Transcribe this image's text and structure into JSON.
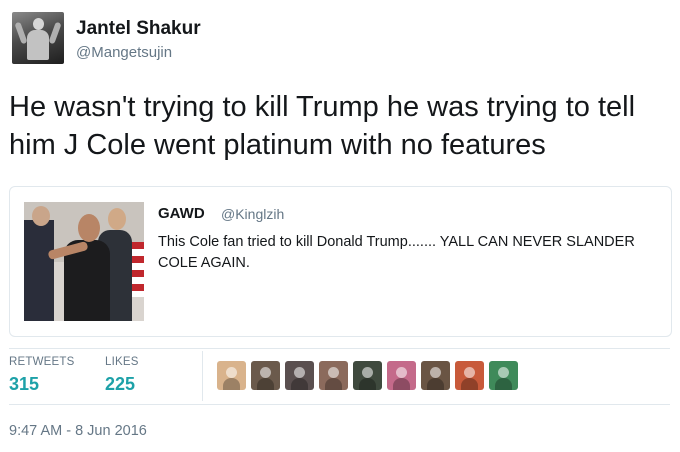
{
  "author": {
    "display_name": "Jantel Shakur",
    "screen_name": "@Mangetsujin"
  },
  "tweet": {
    "text": "He wasn't trying to kill Trump he was trying to tell him J Cole went platinum with no features"
  },
  "quoted_tweet": {
    "display_name": "GAWD",
    "screen_name": "@Kinglzih",
    "text": "This Cole fan tried to kill Donald Trump....... YALL CAN NEVER SLANDER COLE AGAIN."
  },
  "stats": {
    "retweets_label": "RETWEETS",
    "retweets_count": "315",
    "likes_label": "LIKES",
    "likes_count": "225"
  },
  "liker_avatars": [
    {
      "name": "liker-avatar-1",
      "color": "#d9b38c"
    },
    {
      "name": "liker-avatar-2",
      "color": "#6b5a4c"
    },
    {
      "name": "liker-avatar-3",
      "color": "#5a4f4f"
    },
    {
      "name": "liker-avatar-4",
      "color": "#8b6a5c"
    },
    {
      "name": "liker-avatar-5",
      "color": "#3f4a3e"
    },
    {
      "name": "liker-avatar-6",
      "color": "#c46a8a"
    },
    {
      "name": "liker-avatar-7",
      "color": "#6a5544"
    },
    {
      "name": "liker-avatar-8",
      "color": "#c85a3a"
    },
    {
      "name": "liker-avatar-9",
      "color": "#3f8a5a"
    }
  ],
  "meta": {
    "timestamp": "9:47 AM - 8 Jun 2016"
  },
  "colors": {
    "count_accent": "#1da1a8",
    "secondary_text": "#657786",
    "border": "#e1e8ed"
  }
}
